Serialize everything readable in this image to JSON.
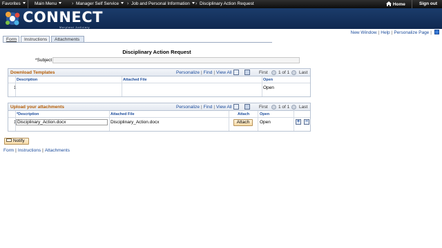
{
  "topnav": {
    "favorites": "Favorites",
    "main_menu": "Main Menu",
    "breadcrumbs": [
      "Manager Self Service",
      "Job and Personal Information",
      "Disciplinary Action Request"
    ],
    "home": "Home",
    "sign_out": "Sign out"
  },
  "banner": {
    "logo_text": "CONNECT",
    "logo_sub": "Maryland Judiciary"
  },
  "utility": {
    "new_window": "New Window",
    "help": "Help",
    "personalize_page": "Personalize Page"
  },
  "tabs": [
    "Form",
    "Instructions",
    "Attachments"
  ],
  "page_title": "Disciplinary Action Request",
  "subject": {
    "label": "*Subject",
    "value": ""
  },
  "download_grid": {
    "title": "Download Templates",
    "links": [
      "Personalize",
      "Find",
      "View All"
    ],
    "first": "First",
    "range": "1 of 1",
    "last": "Last",
    "columns": [
      "Description",
      "Attached File",
      "Open"
    ],
    "rows": [
      {
        "num": "1",
        "description": "",
        "attached_file": "",
        "open": "Open"
      }
    ]
  },
  "upload_grid": {
    "title": "Upload your attachments",
    "links": [
      "Personalize",
      "Find",
      "View All"
    ],
    "first": "First",
    "range": "1 of 1",
    "last": "Last",
    "columns": [
      "*Description",
      "Attached File",
      "Attach",
      "Open"
    ],
    "rows": [
      {
        "num": "1",
        "description": "Disciplinary_Action.docx",
        "attached_file": "Disciplinary_Action.docx",
        "attach": "Attach",
        "open": "Open",
        "add": "+",
        "remove": "−"
      }
    ]
  },
  "notify_label": "Notify",
  "bottom_links": [
    "Form",
    "Instructions",
    "Attachments"
  ],
  "colors": {
    "topnav_bg": "#1a1a1a",
    "banner_bg": "#173766",
    "link": "#1a4b9b",
    "grid_title": "#b35a00"
  }
}
